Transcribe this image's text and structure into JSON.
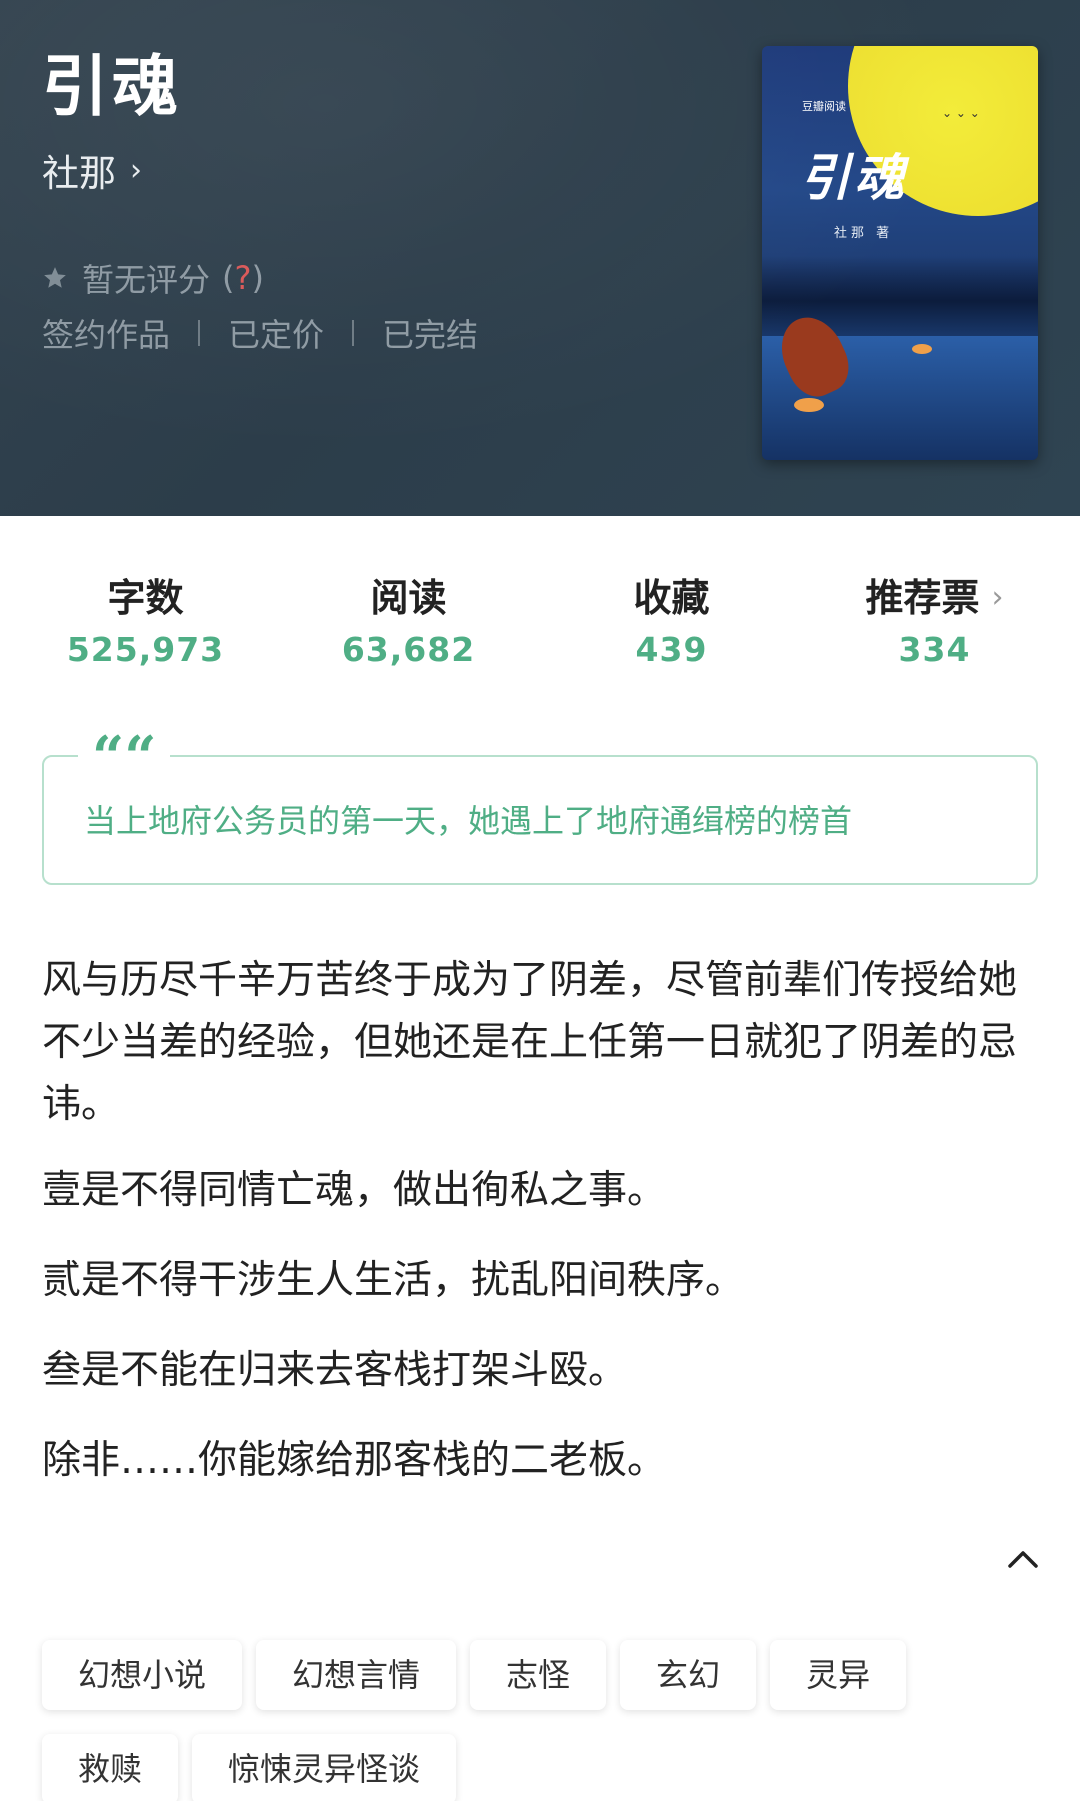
{
  "book": {
    "title": "引魂",
    "author": "社那",
    "rating_text": "暂无评分",
    "rating_help_open": "(",
    "rating_help_q": "?",
    "rating_help_close": ")",
    "meta": [
      "签约作品",
      "已定价",
      "已完结"
    ]
  },
  "cover": {
    "publisher": "豆瓣阅读",
    "title": "引魂",
    "author_line": "社那  著"
  },
  "stats": [
    {
      "label": "字数",
      "value": "525,973"
    },
    {
      "label": "阅读",
      "value": "63,682"
    },
    {
      "label": "收藏",
      "value": "439"
    },
    {
      "label": "推荐票",
      "value": "334"
    }
  ],
  "quote": {
    "mark": "“",
    "text": "当上地府公务员的第一天，她遇上了地府通缉榜的榜首"
  },
  "description": [
    "风与历尽千辛万苦终于成为了阴差，尽管前辈们传授给她不少当差的经验，但她还是在上任第一日就犯了阴差的忌讳。",
    "壹是不得同情亡魂，做出徇私之事。",
    "贰是不得干涉生人生活，扰乱阳间秩序。",
    "叁是不能在归来去客栈打架斗殴。",
    "除非……你能嫁给那客栈的二老板。"
  ],
  "tags": [
    "幻想小说",
    "幻想言情",
    "志怪",
    "玄幻",
    "灵异",
    "救赎",
    "惊悚灵异怪谈"
  ],
  "colors": {
    "accent": "#4fae85",
    "header_bg": "#2f404c",
    "quote_border": "#b7e0cd"
  },
  "icons": {
    "star": "star-icon",
    "author_chevron": "chevron-right-icon",
    "collapse": "chevron-up-icon"
  }
}
